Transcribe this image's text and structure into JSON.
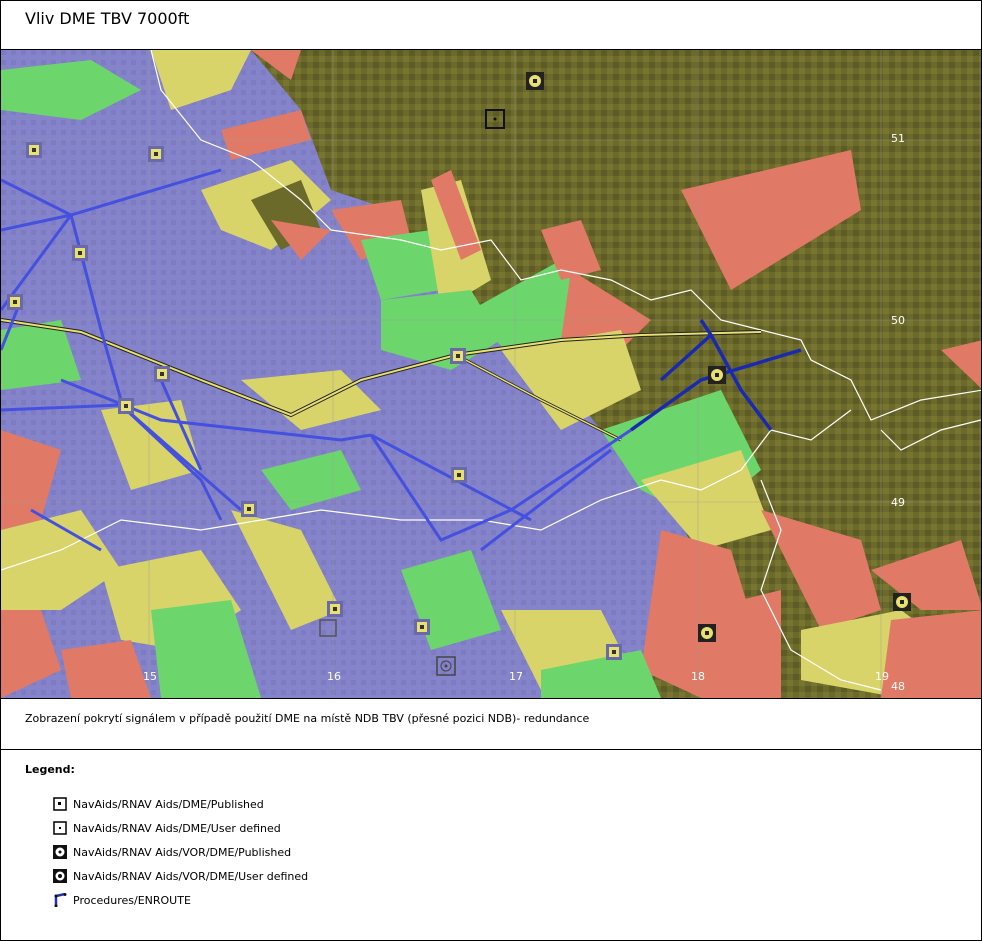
{
  "title": "Vliv DME TBV 7000ft",
  "caption": "Zobrazení pokrytí signálem v případě použití DME na místě NDB TBV (přesné pozici NDB)- redundance",
  "legend": {
    "title": "Legend:",
    "items": [
      {
        "label": "NavAids/RNAV Aids/DME/Published",
        "icon": "dme-published-icon"
      },
      {
        "label": "NavAids/RNAV Aids/DME/User defined",
        "icon": "dme-user-defined-icon"
      },
      {
        "label": "NavAids/RNAV Aids/VOR/DME/Published",
        "icon": "vor-dme-published-icon"
      },
      {
        "label": "NavAids/RNAV Aids/VOR/DME/User defined",
        "icon": "vor-dme-user-defined-icon"
      },
      {
        "label": "Procedures/ENROUTE",
        "icon": "enroute-procedure-icon"
      }
    ]
  },
  "map": {
    "longitude_labels": [
      "15",
      "16",
      "17",
      "18",
      "19"
    ],
    "latitude_labels": [
      "51",
      "50",
      "49",
      "48"
    ],
    "colors": {
      "terrain": "#6b6a2a",
      "coverage_blue": "#8080c8",
      "coverage_green": "#6cd66c",
      "coverage_yellow": "#d8d46a",
      "coverage_red": "#e07a66",
      "route": "#3344cc",
      "airway": "#e8e070",
      "border": "#ffffff"
    }
  }
}
